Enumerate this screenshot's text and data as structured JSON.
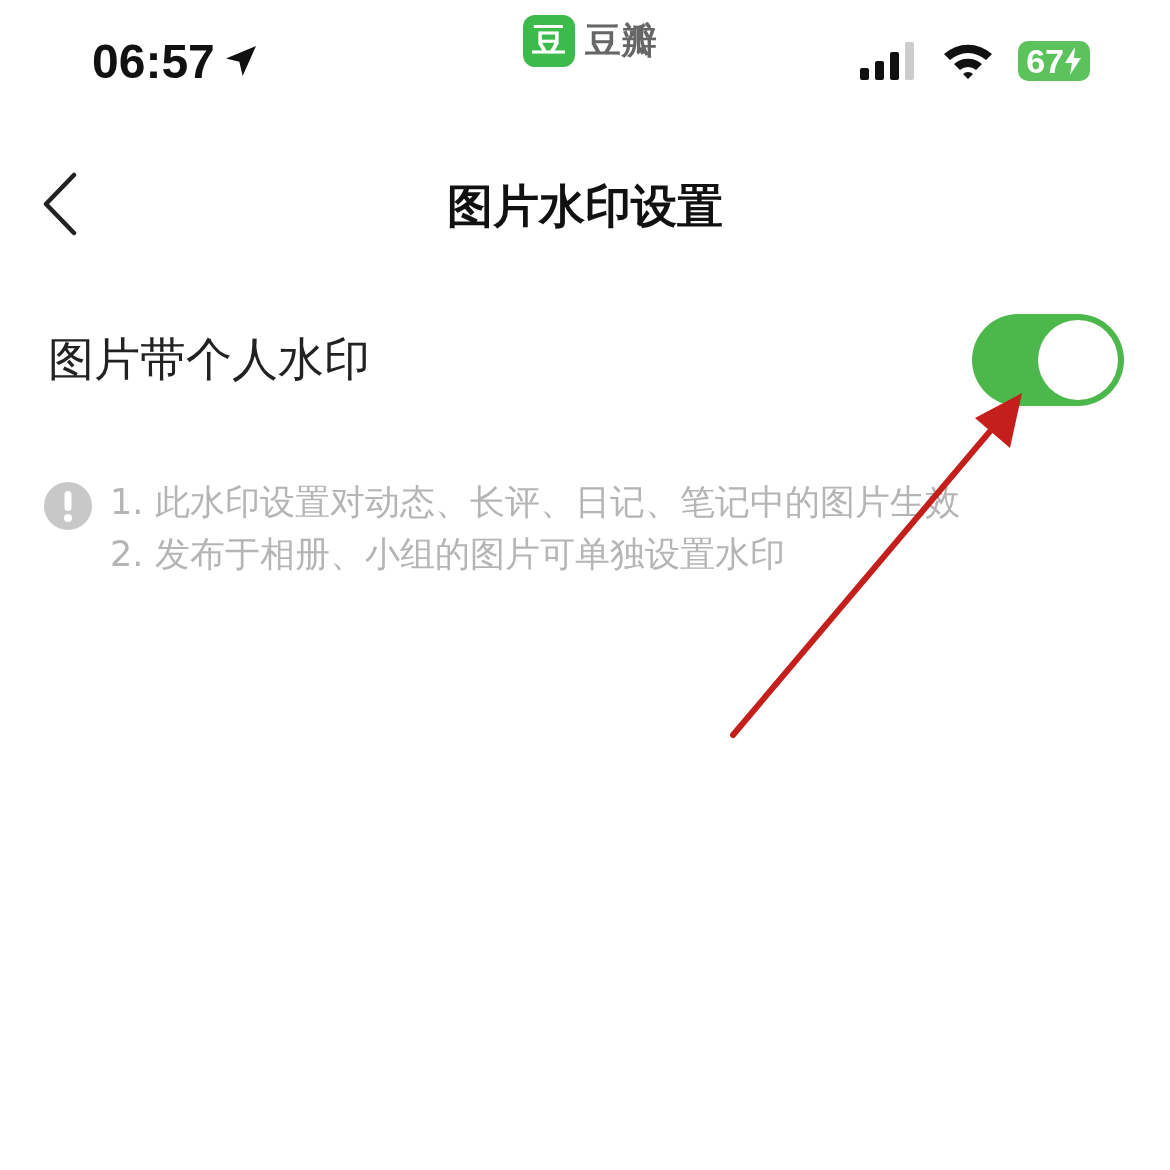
{
  "status_bar": {
    "time": "06:57",
    "app_name": "豆瓣",
    "app_icon_text": "豆",
    "battery": "67"
  },
  "nav": {
    "title": "图片水印设置"
  },
  "setting": {
    "label": "图片带个人水印",
    "on": true
  },
  "notes": [
    "1. 此水印设置对动态、长评、日记、笔记中的图片生效",
    "2. 发布于相册、小组的图片可单独设置水印"
  ]
}
